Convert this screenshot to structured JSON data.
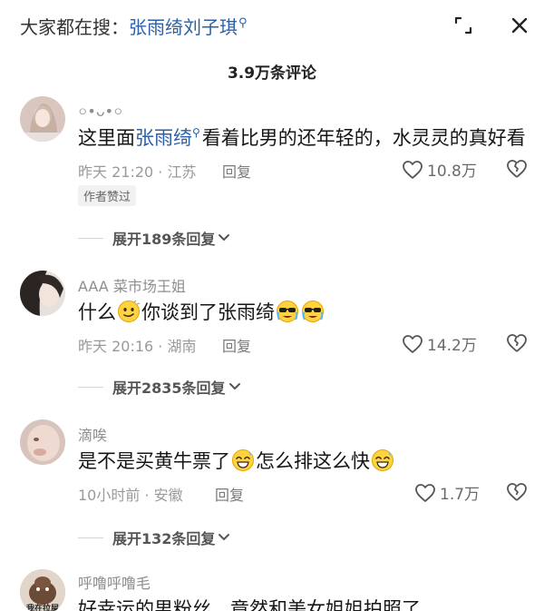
{
  "search": {
    "prefix": "大家都在搜：",
    "keyword": "张雨绮刘子琪",
    "glyph": "⚲"
  },
  "header": {
    "comment_count": "3.9万条评论"
  },
  "comments": [
    {
      "username": "০•ᴗ•০",
      "content_prefix": "这里面",
      "content_keyword": "张雨绮",
      "content_suffix": "看着比男的还年轻的，水灵灵的真好看",
      "time": "昨天 21:20 · 江苏",
      "reply": "回复",
      "likes": "10.8万",
      "badge": "作者赞过",
      "expand": "展开189条回复"
    },
    {
      "username": "AAA 菜市场王姐",
      "content_a": "什么",
      "content_b": "你谈到了张雨绮",
      "time": "昨天 20:16 · 湖南",
      "reply": "回复",
      "likes": "14.2万",
      "expand": "展开2835条回复"
    },
    {
      "username": "滴唉",
      "content_a": "是不是买黄牛票了",
      "content_b": "怎么排这么快",
      "time": "10小时前 · 安徽",
      "reply": "回复",
      "likes": "1.7万",
      "expand": "展开132条回复"
    },
    {
      "username": "呼噜呼噜毛",
      "content": "好幸运的男粉丝，竟然和美女姐姐拍照了",
      "avatar_text": "我在拉屎"
    }
  ],
  "icons": {
    "expand": "expand-icon",
    "close": "close-icon",
    "like": "heart-outline-icon",
    "dislike": "broken-heart-icon",
    "chevron": "chevron-down-icon"
  },
  "colors": {
    "keyword": "#2b5fa8",
    "meta": "#9a9a9a",
    "text": "#161616"
  }
}
